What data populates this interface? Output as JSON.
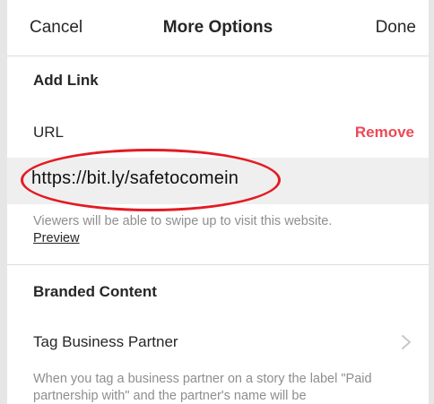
{
  "navbar": {
    "cancel_label": "Cancel",
    "title": "More Options",
    "done_label": "Done"
  },
  "add_link": {
    "section_title": "Add Link",
    "url_label": "URL",
    "remove_label": "Remove",
    "url_value": "https://bit.ly/safetocomein",
    "hint_text": "Viewers will be able to swipe up to visit this website.",
    "preview_label": "Preview"
  },
  "branded_content": {
    "section_title": "Branded Content",
    "tag_partner_label": "Tag Business Partner",
    "tag_description": "When you tag a business partner on a story the label \"Paid partnership with\" and the partner's name will be"
  },
  "colors": {
    "remove_red": "#ed4956",
    "annotation_red": "#e31b23",
    "url_box_bg": "#efefef",
    "secondary_text": "#8e8e8e"
  },
  "icons": {
    "row_chevron": "chevron-right-icon"
  }
}
